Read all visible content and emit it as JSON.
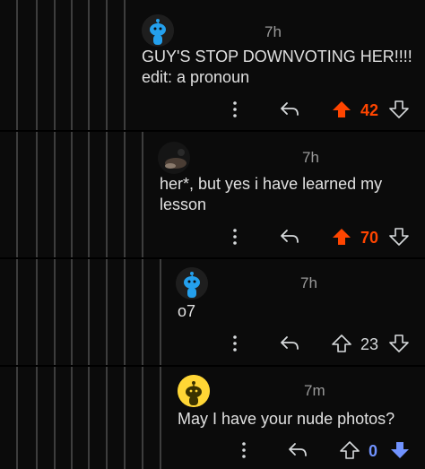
{
  "colors": {
    "upvote": "#ff4500",
    "downvote": "#7193ff",
    "neutral": "#d7dadc",
    "background": "#0b0b0b",
    "thread_line": "#3d3d3d"
  },
  "comments": [
    {
      "timestamp": "7h",
      "body": "GUY'S STOP DOWNVOTING HER!!!!\nedit: a pronoun",
      "score": "42",
      "vote_state": "upvoted",
      "avatar": "snoo-blue-avatar"
    },
    {
      "timestamp": "7h",
      "body": "her*, but yes i have learned my\nlesson",
      "score": "70",
      "vote_state": "upvoted",
      "avatar": "photo-avatar"
    },
    {
      "timestamp": "7h",
      "body": "o7",
      "score": "23",
      "vote_state": "none",
      "avatar": "snoo-blue-avatar"
    },
    {
      "timestamp": "7m",
      "body": "May I have your nude photos?",
      "score": "0",
      "vote_state": "downvoted",
      "avatar": "snoo-yellow-avatar"
    }
  ],
  "icons": {
    "more": "more-options-icon",
    "reply": "reply-icon",
    "upvote": "upvote-arrow-icon",
    "downvote": "downvote-arrow-icon"
  }
}
